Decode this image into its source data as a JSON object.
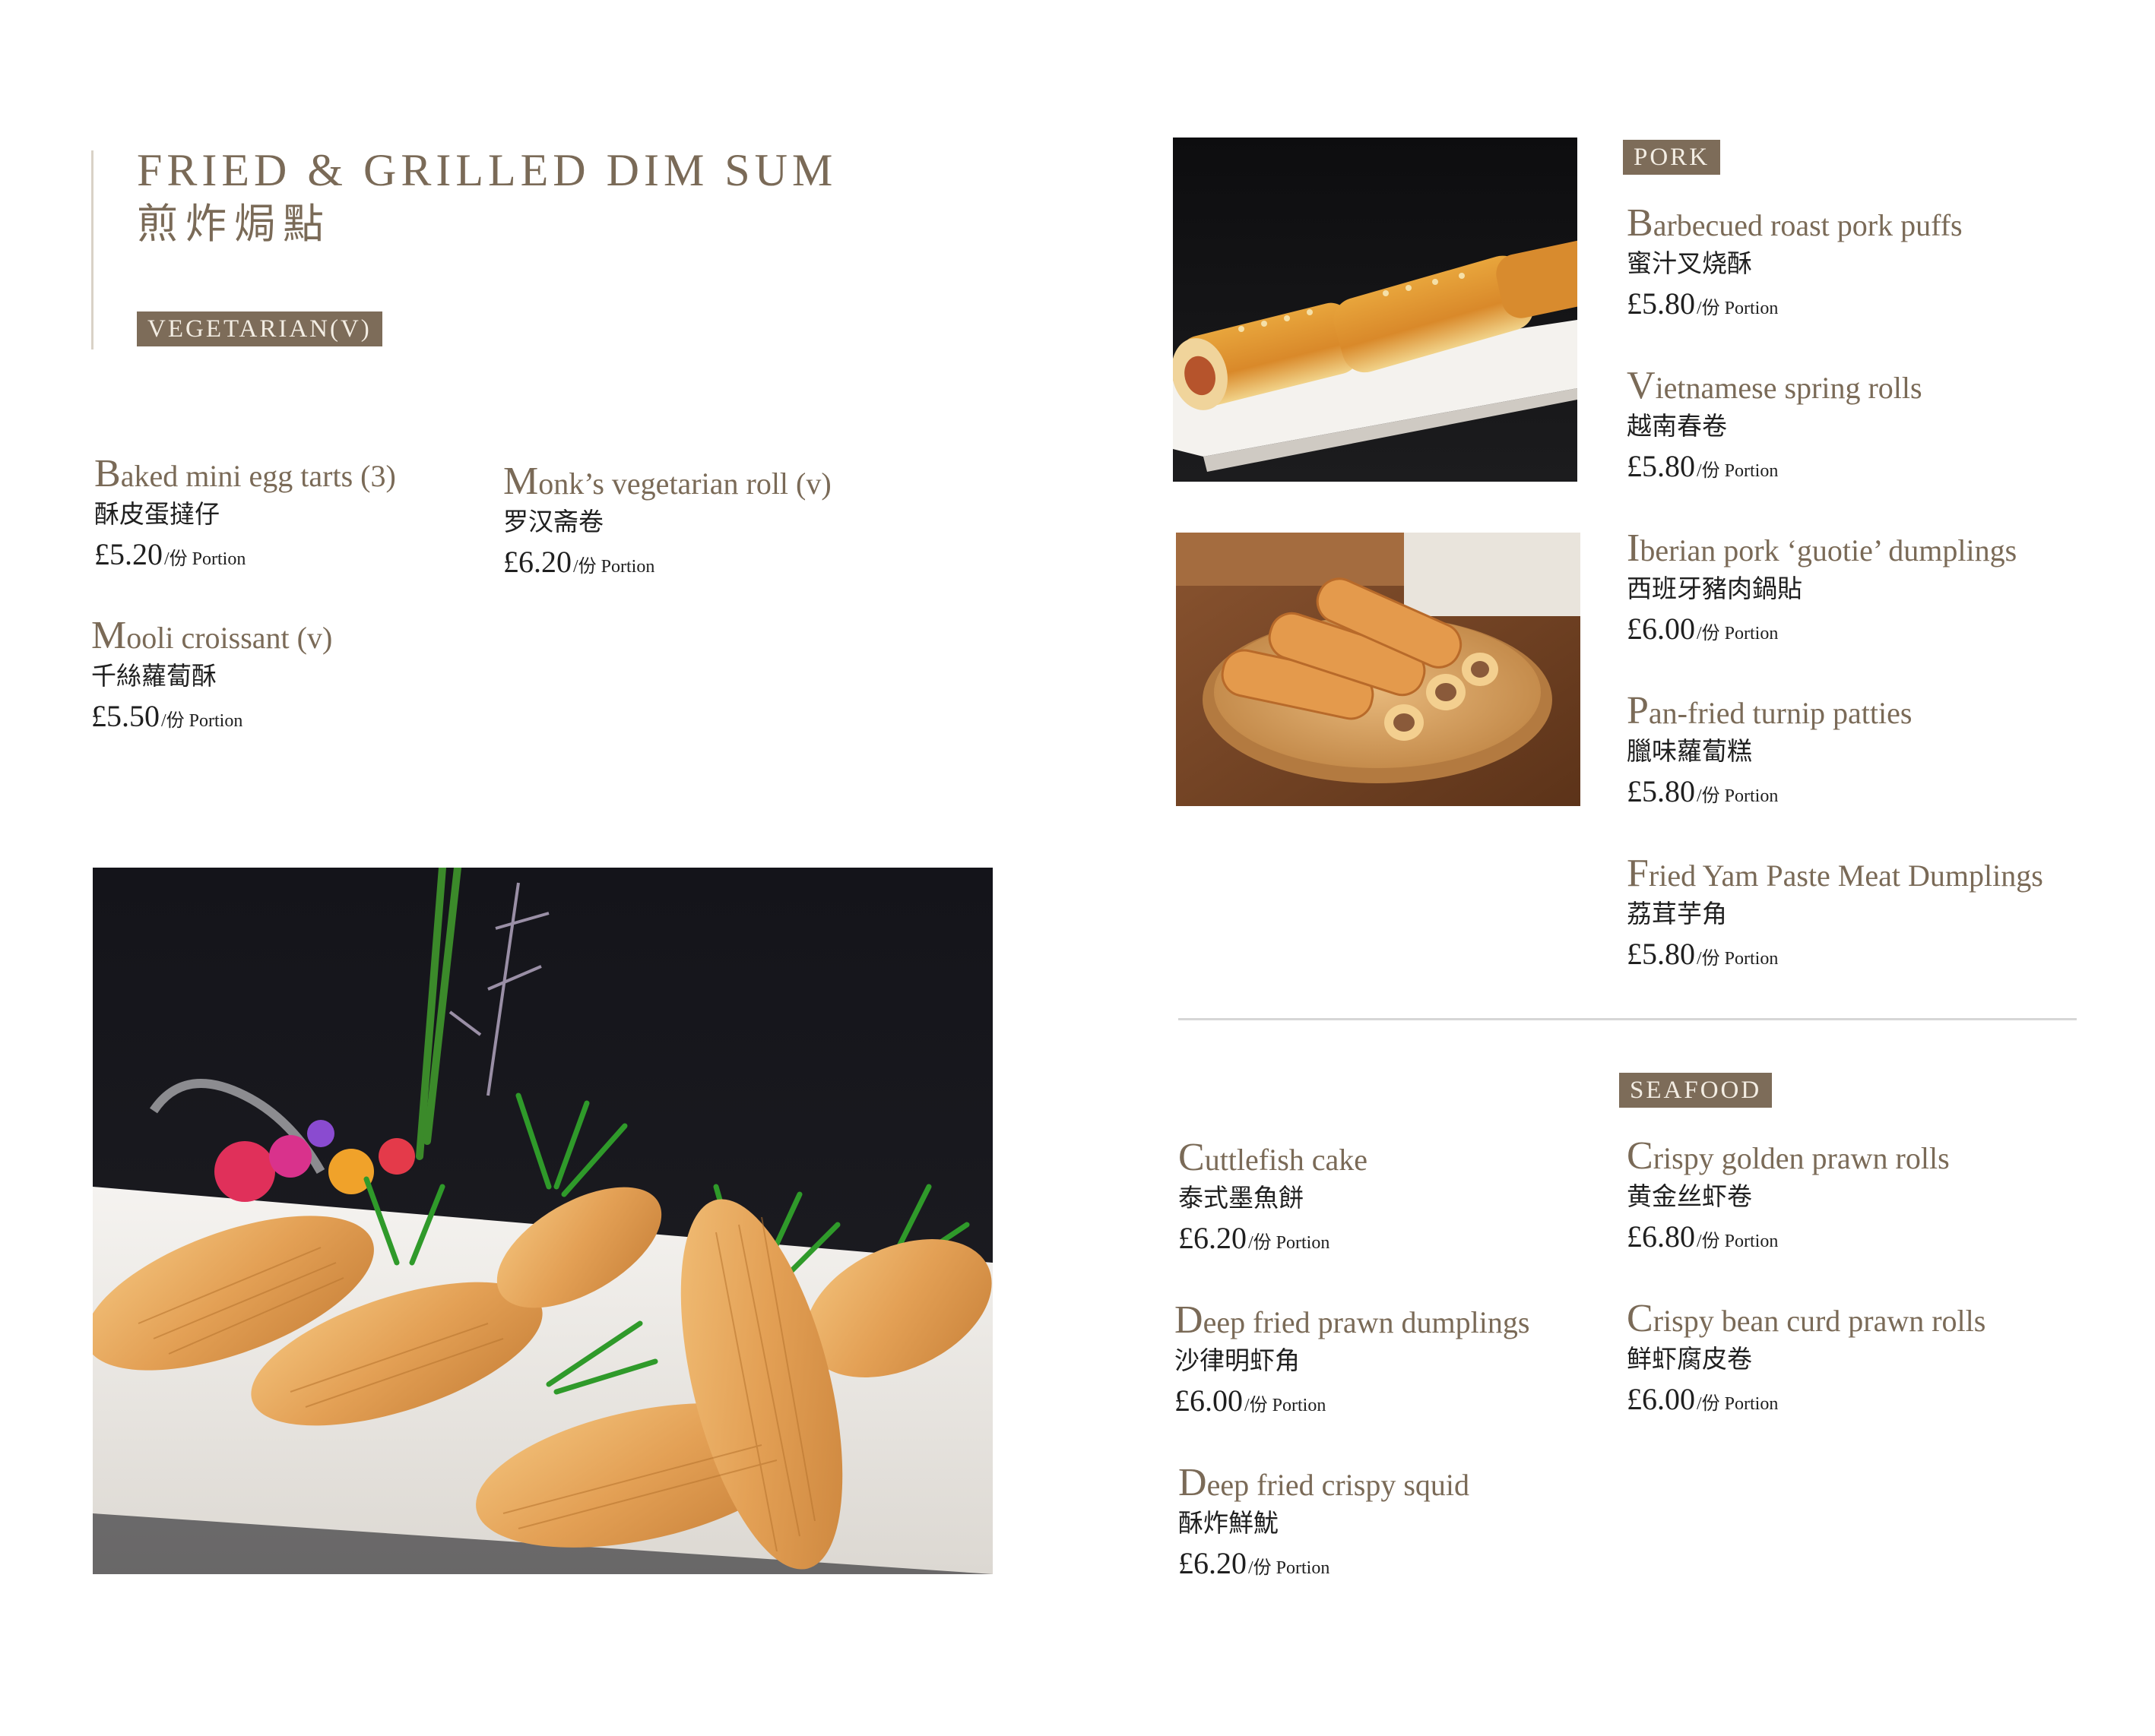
{
  "header": {
    "title_en": "FRIED & GRILLED DIM SUM",
    "title_zh": "煎炸焗點"
  },
  "sections": {
    "vegetarian": "VEGETARIAN(V)",
    "pork": "PORK",
    "seafood": "SEAFOOD"
  },
  "price_suffix": "/份 Portion",
  "vegetarian_items": [
    {
      "en": "Baked mini egg tarts (3)",
      "zh": "酥皮蛋撻仔",
      "price": "£5.20"
    },
    {
      "en": "Monk’s vegetarian roll (v)",
      "zh": "罗汉斋卷",
      "price": "£6.20"
    },
    {
      "en": "Mooli croissant (v)",
      "zh": "千絲蘿蔔酥",
      "price": "£5.50"
    }
  ],
  "pork_items": [
    {
      "en": "Barbecued roast pork puffs",
      "zh": "蜜汁叉烧酥",
      "price": "£5.80"
    },
    {
      "en": "Vietnamese spring rolls",
      "zh": "越南春卷",
      "price": "£5.80"
    },
    {
      "en": "Iberian pork ‘guotie’ dumplings",
      "zh": "西班牙豬肉鍋貼",
      "price": "£6.00"
    },
    {
      "en": "Pan-fried turnip patties",
      "zh": "臘味蘿蔔糕",
      "price": "£5.80"
    },
    {
      "en": "Fried Yam Paste Meat Dumplings",
      "zh": "荔茸芋角",
      "price": "£5.80"
    }
  ],
  "seafood_items": [
    {
      "en": "Cuttlefish cake",
      "zh": "泰式墨魚餅",
      "price": "£6.20"
    },
    {
      "en": "Deep fried prawn dumplings",
      "zh": "沙律明虾角",
      "price": "£6.00"
    },
    {
      "en": "Deep fried crispy squid",
      "zh": "酥炸鮮魷",
      "price": "£6.20"
    },
    {
      "en": "Crispy golden prawn rolls",
      "zh": "黄金丝虾卷",
      "price": "£6.80"
    },
    {
      "en": "Crispy bean curd prawn rolls",
      "zh": "鲜虾腐皮卷",
      "price": "£6.00"
    }
  ],
  "colors": {
    "accent": "#7a6a57",
    "tag_bg": "#7d6c59",
    "text": "#1f1f1f",
    "rule": "#d6d6d6"
  }
}
